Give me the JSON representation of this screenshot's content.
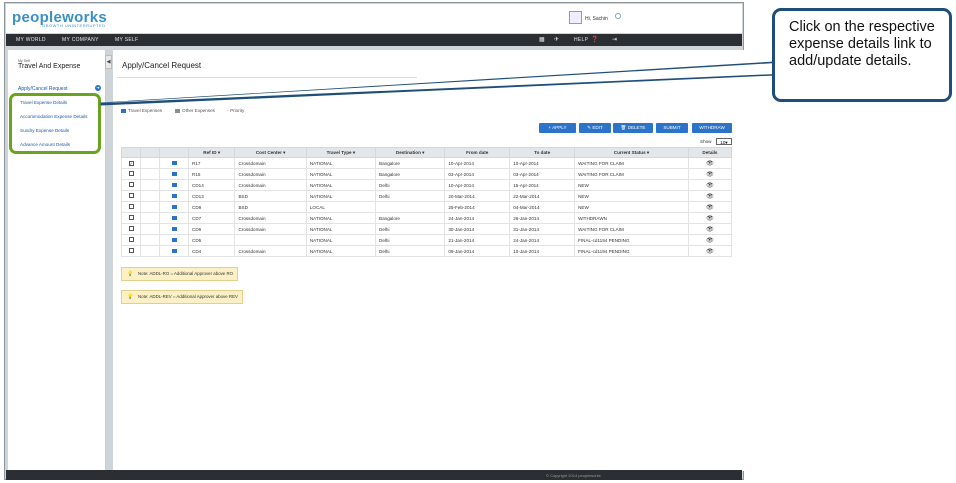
{
  "app": {
    "logo": "peopleworks",
    "tagline": "GROWTH UNINTERRUPTED",
    "greeting": "Hi, Sachin"
  },
  "nav": {
    "items": [
      "MY WORLD",
      "MY COMPANY",
      "MY SELF"
    ],
    "help": "HELP"
  },
  "sidebar": {
    "small_label": "My Self",
    "title": "Travel And Expense",
    "active": "Apply/Cancel Request",
    "links": [
      "Travel Expense Details",
      "Accommodation Expense Details",
      "Sundry Expense Details",
      "Advance Amount Details"
    ]
  },
  "main": {
    "title": "Apply/Cancel Request",
    "legend": [
      "Travel Expenses",
      "Other Expenses",
      "Priority"
    ],
    "buttons": {
      "apply": "APPLY",
      "edit": "EDIT",
      "delete": "DELETE",
      "submit": "SUBMIT",
      "withdraw": "WITHDRAW"
    },
    "show_label": "Show",
    "show_value": "10",
    "columns": [
      "Ref ID",
      "Cost Center",
      "Travel Type",
      "Destination",
      "From date",
      "To date",
      "Current Status",
      "Details"
    ],
    "rows": [
      {
        "checked": true,
        "ref": "R17",
        "cost": "Crossdomain",
        "type": "NATIONAL",
        "dest": "Bangalore",
        "from": "10-Apr-2014",
        "to": "10-Apr-2014",
        "status": "WAITING FOR CLAIM"
      },
      {
        "checked": false,
        "ref": "R15",
        "cost": "Crossdomain",
        "type": "NATIONAL",
        "dest": "Bangalore",
        "from": "03-Apr-2014",
        "to": "03-Apr-2014",
        "status": "WAITING FOR CLAIM"
      },
      {
        "checked": false,
        "ref": "CD14",
        "cost": "Crossdomain",
        "type": "NATIONAL",
        "dest": "Delhi",
        "from": "10-Apr-2014",
        "to": "15-Apr-2014",
        "status": "NEW"
      },
      {
        "checked": false,
        "ref": "CD13",
        "cost": "BSD",
        "type": "NATIONAL",
        "dest": "Delhi",
        "from": "20-Mar-2014",
        "to": "22-Mar-2014",
        "status": "NEW"
      },
      {
        "checked": false,
        "ref": "CD9",
        "cost": "BSD",
        "type": "LOCAL",
        "dest": "",
        "from": "25-Feb-2014",
        "to": "04-Mar-2014",
        "status": "NEW"
      },
      {
        "checked": false,
        "ref": "CD7",
        "cost": "Crossdomain",
        "type": "NATIONAL",
        "dest": "Bangalore",
        "from": "24-Jan-2014",
        "to": "26-Jan-2014",
        "status": "WITHDRAWN"
      },
      {
        "checked": false,
        "ref": "CD6",
        "cost": "Crossdomain",
        "type": "NATIONAL",
        "dest": "Delhi",
        "from": "30-Jan-2014",
        "to": "31-Jan-2014",
        "status": "WAITING FOR CLAIM"
      },
      {
        "checked": false,
        "ref": "CD5",
        "cost": "",
        "type": "NATIONAL",
        "dest": "Delhi",
        "from": "21-Jan-2014",
        "to": "24-Jan-2014",
        "status": "FINAL-cd1194 PENDING"
      },
      {
        "checked": false,
        "ref": "CD4",
        "cost": "Crossdomain",
        "type": "NATIONAL",
        "dest": "Delhi",
        "from": "09-Jan-2014",
        "to": "10-Jan-2014",
        "status": "FINAL-cd1194 PENDING"
      }
    ],
    "notes": [
      "Note: ADDL-RO = Additional Approver above RO",
      "Note: ADDL-REV = Additional Approver above REV"
    ]
  },
  "footer": {
    "copyright": "© Copyright 2014 peopleworks"
  },
  "callout": {
    "text": "Click on the respective expense details link to add/update details."
  },
  "colors": {
    "accent": "#2b74c9",
    "highlight_box": "#6aa31d",
    "callout_border": "#1f4e79",
    "navbar": "#2b2f33"
  }
}
